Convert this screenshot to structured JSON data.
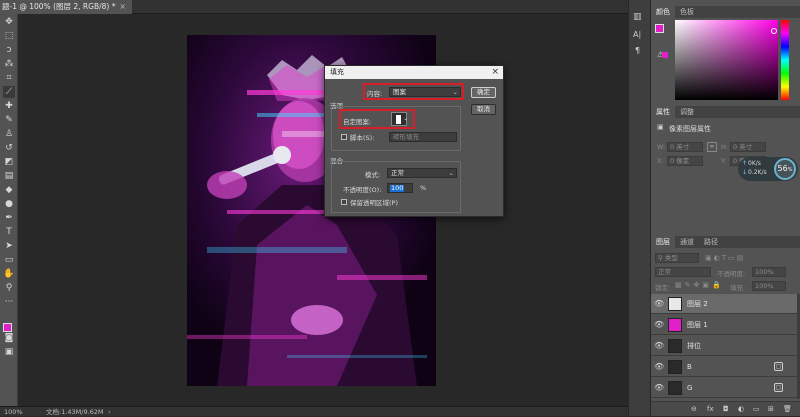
{
  "document": {
    "tab_title": "题-1 @ 100% (图层 2, RGB/8) *",
    "close": "×"
  },
  "status": {
    "zoom": "100%",
    "doc_info": "文档:1.43M/9.62M"
  },
  "toolbar_icons": [
    "move-icon",
    "marquee-icon",
    "lasso-icon",
    "quick-select-icon",
    "crop-icon",
    "eyedropper-icon",
    "healing-icon",
    "brush-icon",
    "stamp-icon",
    "history-brush-icon",
    "eraser-icon",
    "gradient-icon",
    "blur-icon",
    "dodge-icon",
    "pen-icon",
    "type-icon",
    "path-select-icon",
    "shape-icon",
    "hand-icon",
    "zoom-icon",
    "more-icon"
  ],
  "colors": {
    "foreground": "#e020c8",
    "background": "#20c8d0",
    "accent_red": "#d81e2a",
    "swatch_picked": "#e020c8"
  },
  "panels": {
    "color": {
      "tabs": [
        "颜色",
        "色板"
      ]
    },
    "properties": {
      "tabs": [
        "属性",
        "调整"
      ],
      "header": "像素图层属性",
      "w_label": "W:",
      "w_value": "0 英寸",
      "h_label": "H:",
      "h_value": "0 英寸",
      "x_label": "X:",
      "x_value": "0 像素",
      "y_label": "Y:",
      "y_value": "0 像素",
      "stat1": "0K/s",
      "stat2": "0.2K/s",
      "perf": "56",
      "perf_unit": "%"
    },
    "layers": {
      "tabs": [
        "图层",
        "通道",
        "路径"
      ],
      "kind_filter": "类型",
      "blend_mode": "正常",
      "opacity_label": "不透明度:",
      "opacity_value": "100%",
      "lock_label": "锁定:",
      "fill_label": "填充:",
      "fill_value": "100%",
      "items": [
        {
          "name": "图层 2",
          "thumb_color": "#e8e8e8",
          "badge": ""
        },
        {
          "name": "图层 1",
          "thumb_color": "#e020c8",
          "badge": ""
        },
        {
          "name": "排位",
          "thumb_color": "#2a2a2a",
          "badge": ""
        },
        {
          "name": "B",
          "thumb_color": "#2a2a2a",
          "badge": "▢"
        },
        {
          "name": "G",
          "thumb_color": "#2a2a2a",
          "badge": "▢"
        }
      ],
      "footer_icons": [
        "link-icon",
        "fx-icon",
        "mask-icon",
        "adjustment-icon",
        "group-icon",
        "new-layer-icon",
        "trash-icon"
      ],
      "footer_labels": [
        "⊖",
        "fx",
        "◘",
        "◐",
        "▭",
        "⊞",
        "🗑"
      ]
    }
  },
  "side_icons": {
    "labels": [
      "A|",
      "¶"
    ]
  },
  "fill_dialog": {
    "title": "填充",
    "close": "×",
    "content_label": "内容:",
    "content_value": "图案",
    "options_title": "选项",
    "custom_pattern_label": "自定图案:",
    "script_label": "脚本(S):",
    "script_value": "砖形填充",
    "blending_title": "混合",
    "mode_label": "模式:",
    "mode_value": "正常",
    "opacity_label": "不透明度(O):",
    "opacity_value": "100",
    "opacity_unit": "%",
    "preserve_label": "保留透明区域(P)",
    "ok_button": "确定",
    "cancel_button": "取消"
  }
}
